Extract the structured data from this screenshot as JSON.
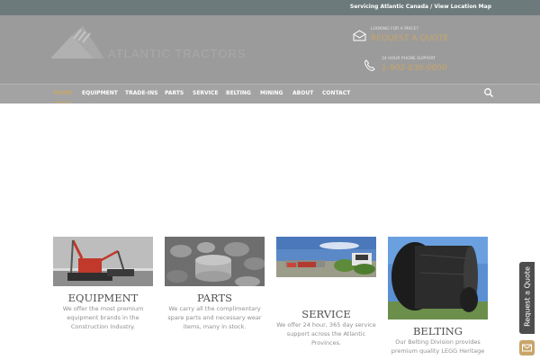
{
  "topbar": {
    "text": "Servicing Atlantic Canada / View Location Map"
  },
  "header": {
    "logo_text": "ATLANTIC TRACTORS",
    "quote_small": "LOOKING FOR A PRICE?",
    "quote_big": "REQUEST A QUOTE",
    "phone_small": "24 HOUR PHONE SUPPORT",
    "phone_big": "1-902-830-0000",
    "icons": {
      "quote": "envelope-icon",
      "phone": "phone-icon"
    }
  },
  "nav": {
    "items": [
      {
        "label": "HOME",
        "active": true
      },
      {
        "label": "EQUIPMENT"
      },
      {
        "label": "TRADE-INS"
      },
      {
        "label": "PARTS"
      },
      {
        "label": "SERVICE"
      },
      {
        "label": "BELTING"
      },
      {
        "label": "MINING"
      },
      {
        "label": "ABOUT"
      },
      {
        "label": "CONTACT"
      }
    ],
    "search_icon": "search-icon"
  },
  "cards": [
    {
      "title": "EQUIPMENT",
      "body": "We offer the most premium equipment brands in the Construction Industry."
    },
    {
      "title": "PARTS",
      "body": "We carry all the complimentary spare parts and necessary wear items, many in stock."
    },
    {
      "title": "SERVICE",
      "body": "We offer 24 hour, 365 day service support across the Atlantic Provinces."
    },
    {
      "title": "BELTING",
      "body": "Our Belting Division provides premium quality LEGG Heritage"
    }
  ],
  "sidebar_tab": {
    "label": "Request a Quote",
    "mail_icon": "envelope-icon"
  },
  "colors": {
    "accent": "#c9a56a",
    "topbar": "#6d7a7c",
    "header": "#9b9b9b",
    "nav": "#a3a3a3"
  }
}
